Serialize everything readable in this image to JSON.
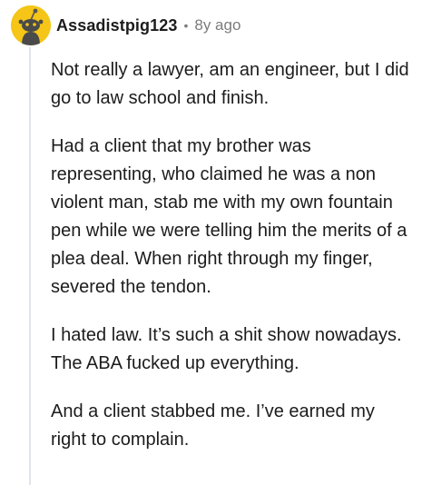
{
  "comment": {
    "author": "Assadistpig123",
    "separator": "•",
    "age": "8y ago",
    "avatar_icon": "snoo-avatar-icon",
    "avatar_color": "#f1c40f",
    "paragraphs": [
      "Not really a lawyer, am an engineer, but I did go to law school and finish.",
      "Had a client that my brother was representing, who claimed he was a non violent man, stab me with my own fountain pen while we were telling him the merits of a plea deal. When right through my finger, severed the tendon.",
      "I hated law. It’s such a shit show nowadays. The ABA fucked up everything.",
      "And a client stabbed me. I’ve earned my right to complain."
    ]
  }
}
